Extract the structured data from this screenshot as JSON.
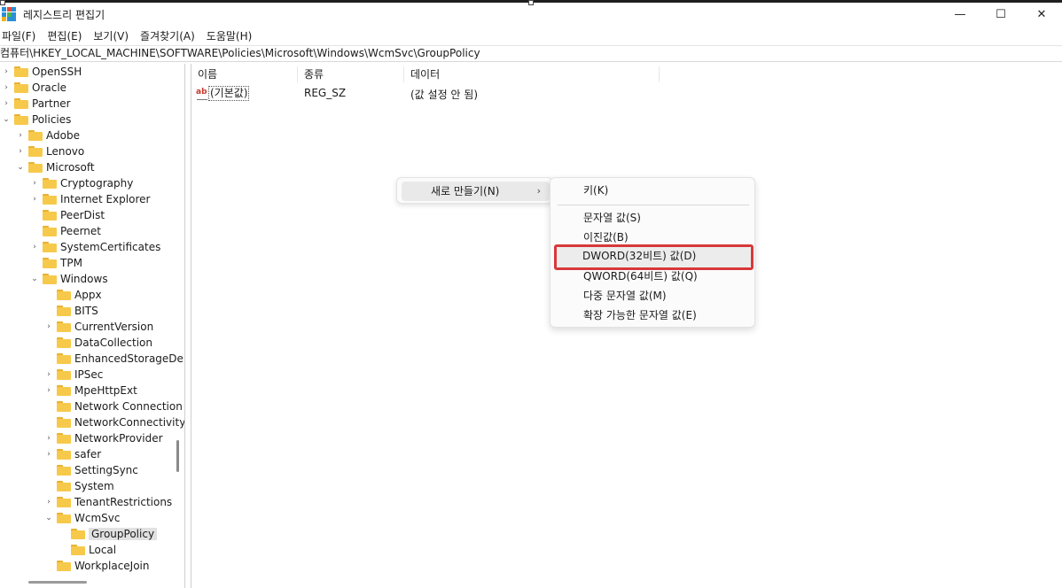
{
  "window": {
    "title": "레지스트리 편집기",
    "controls": [
      "—",
      "☐",
      "✕"
    ]
  },
  "menu": [
    "파일(F)",
    "편집(E)",
    "보기(V)",
    "즐겨찾기(A)",
    "도움말(H)"
  ],
  "address": "컴퓨터\\HKEY_LOCAL_MACHINE\\SOFTWARE\\Policies\\Microsoft\\Windows\\WcmSvc\\GroupPolicy",
  "tree": [
    {
      "label": "OpenSSH",
      "chevron": "›"
    },
    {
      "label": "Oracle",
      "chevron": "›"
    },
    {
      "label": "Partner",
      "chevron": "›"
    },
    {
      "label": "Policies",
      "chevron": "⌄"
    },
    {
      "label": "Adobe",
      "chevron": "›"
    },
    {
      "label": "Lenovo",
      "chevron": "›"
    },
    {
      "label": "Microsoft",
      "chevron": "⌄"
    },
    {
      "label": "Cryptography",
      "chevron": "›"
    },
    {
      "label": "Internet Explorer",
      "chevron": "›"
    },
    {
      "label": "PeerDist",
      "chevron": ""
    },
    {
      "label": "Peernet",
      "chevron": ""
    },
    {
      "label": "SystemCertificates",
      "chevron": "›"
    },
    {
      "label": "TPM",
      "chevron": ""
    },
    {
      "label": "Windows",
      "chevron": "⌄"
    },
    {
      "label": "Appx",
      "chevron": ""
    },
    {
      "label": "BITS",
      "chevron": ""
    },
    {
      "label": "CurrentVersion",
      "chevron": "›"
    },
    {
      "label": "DataCollection",
      "chevron": ""
    },
    {
      "label": "EnhancedStorageDe",
      "chevron": ""
    },
    {
      "label": "IPSec",
      "chevron": "›"
    },
    {
      "label": "MpeHttpExt",
      "chevron": "›"
    },
    {
      "label": "Network Connection",
      "chevron": ""
    },
    {
      "label": "NetworkConnectivity",
      "chevron": ""
    },
    {
      "label": "NetworkProvider",
      "chevron": "›"
    },
    {
      "label": "safer",
      "chevron": "›"
    },
    {
      "label": "SettingSync",
      "chevron": ""
    },
    {
      "label": "System",
      "chevron": ""
    },
    {
      "label": "TenantRestrictions",
      "chevron": "›"
    },
    {
      "label": "WcmSvc",
      "chevron": "⌄"
    },
    {
      "label": "GroupPolicy",
      "chevron": "",
      "selected": true
    },
    {
      "label": "Local",
      "chevron": ""
    },
    {
      "label": "WorkplaceJoin",
      "chevron": ""
    }
  ],
  "list": {
    "columns": [
      "이름",
      "종류",
      "데이터"
    ],
    "rows": [
      {
        "name": "(기본값)",
        "type": "REG_SZ",
        "data": "(값 설정 안 됨)"
      }
    ]
  },
  "context_menu": {
    "new_label": "새로 만들기(N)",
    "arrow": "›"
  },
  "submenu": {
    "key": "키(K)",
    "string": "문자열 값(S)",
    "binary": "이진값(B)",
    "dword": "DWORD(32비트) 값(D)",
    "qword": "QWORD(64비트) 값(Q)",
    "multi_string": "다중 문자열 값(M)",
    "expandable_string": "확장 가능한 문자열 값(E)"
  },
  "colors": {
    "highlight_border": "#d7383b",
    "folder": "#f7c94b"
  }
}
